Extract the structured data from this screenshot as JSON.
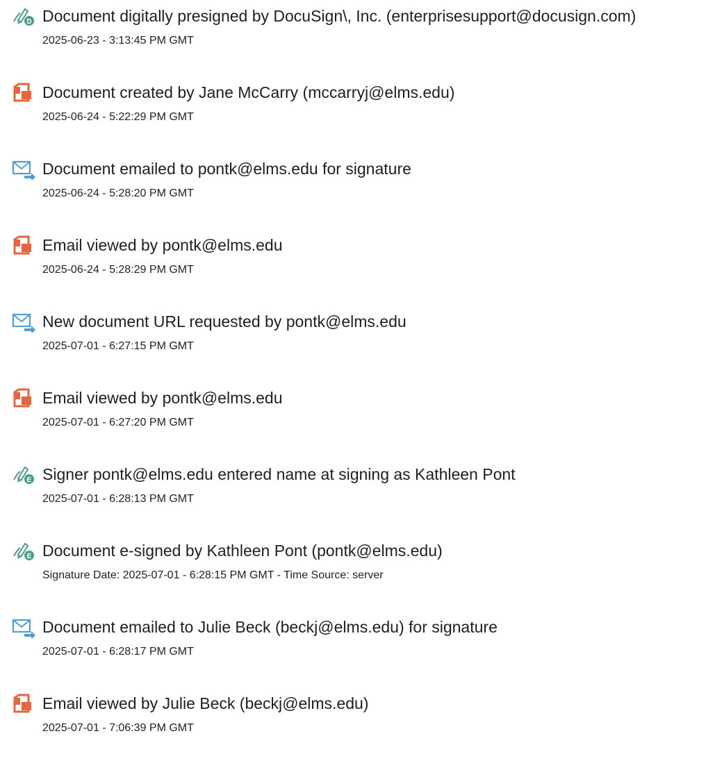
{
  "events": [
    {
      "icon": "pen-sign-d-icon",
      "title": "Document digitally presigned by DocuSign\\, Inc. (enterprisesupport@docusign.com)",
      "detail": "2025-06-23 - 3:13:45 PM GMT"
    },
    {
      "icon": "pdf-document-icon",
      "title": "Document created by Jane McCarry (mccarryj@elms.edu)",
      "detail": "2025-06-24 - 5:22:29 PM GMT"
    },
    {
      "icon": "email-send-icon",
      "title": "Document emailed to pontk@elms.edu for signature",
      "detail": "2025-06-24 - 5:28:20 PM GMT"
    },
    {
      "icon": "pdf-document-icon",
      "title": "Email viewed by pontk@elms.edu",
      "detail": "2025-06-24 - 5:28:29 PM GMT"
    },
    {
      "icon": "email-send-icon",
      "title": "New document URL requested by pontk@elms.edu",
      "detail": "2025-07-01 - 6:27:15 PM GMT"
    },
    {
      "icon": "pdf-document-icon",
      "title": "Email viewed by pontk@elms.edu",
      "detail": "2025-07-01 - 6:27:20 PM GMT"
    },
    {
      "icon": "pen-sign-e-icon",
      "title": "Signer pontk@elms.edu entered name at signing as Kathleen Pont",
      "detail": "2025-07-01 - 6:28:13 PM GMT"
    },
    {
      "icon": "pen-sign-e-icon",
      "title": "Document e-signed by Kathleen Pont (pontk@elms.edu)",
      "detail": "Signature Date: 2025-07-01 - 6:28:15 PM GMT - Time Source: server"
    },
    {
      "icon": "email-send-icon",
      "title": "Document emailed to Julie Beck (beckj@elms.edu) for signature",
      "detail": "2025-07-01 - 6:28:17 PM GMT"
    },
    {
      "icon": "pdf-document-icon",
      "title": "Email viewed by Julie Beck (beckj@elms.edu)",
      "detail": "2025-07-01 - 7:06:39 PM GMT"
    }
  ],
  "colors": {
    "pen_green": "#4a9e8c",
    "pdf_orange": "#e8643c",
    "mail_blue": "#4f9fd6",
    "text": "#1f1f1f"
  }
}
